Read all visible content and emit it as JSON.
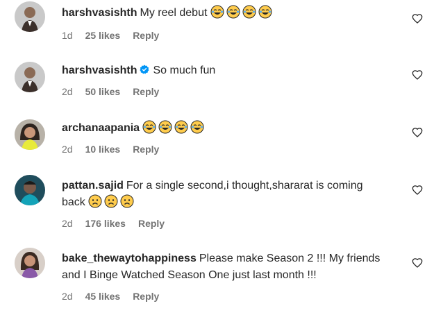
{
  "comments": [
    {
      "username": "harshvasishth",
      "verified": false,
      "text": "My reel debut",
      "emojis": [
        "laughing-tears",
        "laughing-tears",
        "laughing-tears",
        "laughing-tears"
      ],
      "time": "1d",
      "likes": "25 likes",
      "reply": "Reply",
      "avatar_icon": "profile-photo-man-suit"
    },
    {
      "username": "harshvasishth",
      "verified": true,
      "text": "So much fun",
      "emojis": [],
      "time": "2d",
      "likes": "50 likes",
      "reply": "Reply",
      "avatar_icon": "profile-photo-man-suit"
    },
    {
      "username": "archanaapania",
      "verified": false,
      "text": "",
      "emojis": [
        "laughing-tears",
        "laughing-tears",
        "laughing-tears",
        "laughing-tears"
      ],
      "time": "2d",
      "likes": "10 likes",
      "reply": "Reply",
      "avatar_icon": "profile-photo-woman-yellow"
    },
    {
      "username": "pattan.sajid",
      "verified": false,
      "text_line1": "For a single second,i thought,shararat is coming",
      "text_line2": "back",
      "emojis": [
        "sad-face",
        "sad-face",
        "sad-face"
      ],
      "time": "2d",
      "likes": "176 likes",
      "reply": "Reply",
      "avatar_icon": "profile-photo-man-cyan"
    },
    {
      "username": "bake_thewaytohappiness",
      "verified": false,
      "text_line1": "Please make Season 2 !!! My friends",
      "text_line2": "and I Binge Watched Season One just last month !!!",
      "emojis": [],
      "time": "2d",
      "likes": "45 likes",
      "reply": "Reply",
      "avatar_icon": "profile-photo-woman-smiling"
    }
  ],
  "icons": {
    "like": "heart-outline-icon",
    "verified": "verified-badge-icon"
  },
  "colors": {
    "text": "#262626",
    "muted": "#737373",
    "verified": "#0095f6",
    "emoji": "#ffcc4d"
  }
}
